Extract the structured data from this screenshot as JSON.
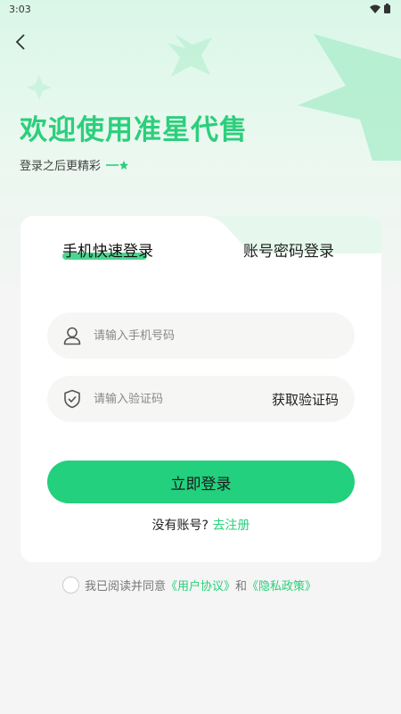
{
  "status_bar": {
    "time": "3:03",
    "wifi_icon": "wifi-icon",
    "battery_icon": "battery-icon"
  },
  "header": {
    "back_icon": "chevron-left-icon"
  },
  "welcome": {
    "title": "欢迎使用准星代售",
    "subtitle": "登录之后更精彩"
  },
  "colors": {
    "accent": "#2ccf7c",
    "button": "#22d07e",
    "background": "#f4f5f4"
  },
  "tabs": [
    {
      "label": "手机快速登录",
      "active": true
    },
    {
      "label": "账号密码登录",
      "active": false
    }
  ],
  "form": {
    "phone": {
      "placeholder": "请输入手机号码",
      "value": "",
      "icon": "user-icon"
    },
    "code": {
      "placeholder": "请输入验证码",
      "value": "",
      "icon": "shield-check-icon",
      "action_label": "获取验证码"
    },
    "submit_label": "立即登录"
  },
  "register": {
    "prompt": "没有账号?",
    "link": "去注册"
  },
  "agreement": {
    "prefix": "我已阅读并同意",
    "user_agreement": "《用户协议》",
    "conjunction": "和",
    "privacy_policy": "《隐私政策》",
    "checked": false
  }
}
